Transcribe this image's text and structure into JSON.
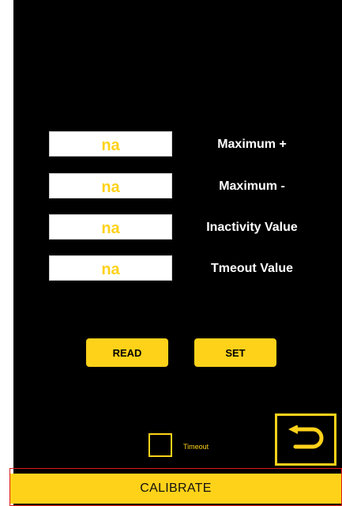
{
  "fields": [
    {
      "value": "na",
      "label": "Maximum +"
    },
    {
      "value": "na",
      "label": "Maximum -"
    },
    {
      "value": "na",
      "label": "Inactivity Value"
    },
    {
      "value": "na",
      "label": "Tmeout Value"
    }
  ],
  "buttons": {
    "read": "READ",
    "set": "SET"
  },
  "timeout": {
    "label": "Timeout",
    "checked": false
  },
  "calibrate": {
    "label": "CALIBRATE"
  },
  "icons": {
    "back": "back-arrow-icon"
  },
  "colors": {
    "accent": "#FFD21A",
    "background": "#000000",
    "highlight": "#E01B1B"
  }
}
